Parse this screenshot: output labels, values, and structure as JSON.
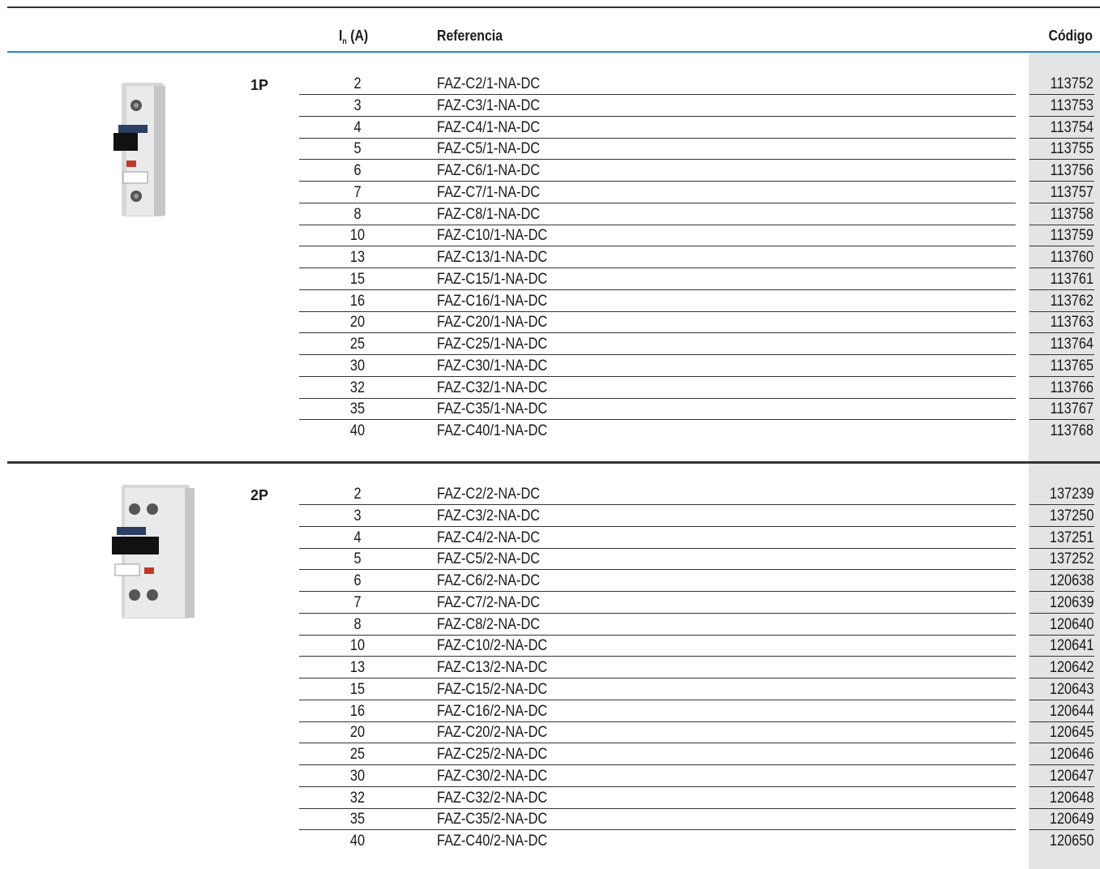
{
  "header": {
    "in_main": "I",
    "in_sub": "n",
    "in_unit": " (A)",
    "ref": "Referencia",
    "code": "Código"
  },
  "sections": [
    {
      "pole": "1P",
      "rows": [
        {
          "in": "2",
          "ref": "FAZ-C2/1-NA-DC",
          "code": "113752"
        },
        {
          "in": "3",
          "ref": "FAZ-C3/1-NA-DC",
          "code": "113753"
        },
        {
          "in": "4",
          "ref": "FAZ-C4/1-NA-DC",
          "code": "113754"
        },
        {
          "in": "5",
          "ref": "FAZ-C5/1-NA-DC",
          "code": "113755"
        },
        {
          "in": "6",
          "ref": "FAZ-C6/1-NA-DC",
          "code": "113756"
        },
        {
          "in": "7",
          "ref": "FAZ-C7/1-NA-DC",
          "code": "113757"
        },
        {
          "in": "8",
          "ref": "FAZ-C8/1-NA-DC",
          "code": "113758"
        },
        {
          "in": "10",
          "ref": "FAZ-C10/1-NA-DC",
          "code": "113759"
        },
        {
          "in": "13",
          "ref": "FAZ-C13/1-NA-DC",
          "code": "113760"
        },
        {
          "in": "15",
          "ref": "FAZ-C15/1-NA-DC",
          "code": "113761"
        },
        {
          "in": "16",
          "ref": "FAZ-C16/1-NA-DC",
          "code": "113762"
        },
        {
          "in": "20",
          "ref": "FAZ-C20/1-NA-DC",
          "code": "113763"
        },
        {
          "in": "25",
          "ref": "FAZ-C25/1-NA-DC",
          "code": "113764"
        },
        {
          "in": "30",
          "ref": "FAZ-C30/1-NA-DC",
          "code": "113765"
        },
        {
          "in": "32",
          "ref": "FAZ-C32/1-NA-DC",
          "code": "113766"
        },
        {
          "in": "35",
          "ref": "FAZ-C35/1-NA-DC",
          "code": "113767"
        },
        {
          "in": "40",
          "ref": "FAZ-C40/1-NA-DC",
          "code": "113768"
        }
      ]
    },
    {
      "pole": "2P",
      "rows": [
        {
          "in": "2",
          "ref": "FAZ-C2/2-NA-DC",
          "code": "137239"
        },
        {
          "in": "3",
          "ref": "FAZ-C3/2-NA-DC",
          "code": "137250"
        },
        {
          "in": "4",
          "ref": "FAZ-C4/2-NA-DC",
          "code": "137251"
        },
        {
          "in": "5",
          "ref": "FAZ-C5/2-NA-DC",
          "code": "137252"
        },
        {
          "in": "6",
          "ref": "FAZ-C6/2-NA-DC",
          "code": "120638"
        },
        {
          "in": "7",
          "ref": "FAZ-C7/2-NA-DC",
          "code": "120639"
        },
        {
          "in": "8",
          "ref": "FAZ-C8/2-NA-DC",
          "code": "120640"
        },
        {
          "in": "10",
          "ref": "FAZ-C10/2-NA-DC",
          "code": "120641"
        },
        {
          "in": "13",
          "ref": "FAZ-C13/2-NA-DC",
          "code": "120642"
        },
        {
          "in": "15",
          "ref": "FAZ-C15/2-NA-DC",
          "code": "120643"
        },
        {
          "in": "16",
          "ref": "FAZ-C16/2-NA-DC",
          "code": "120644"
        },
        {
          "in": "20",
          "ref": "FAZ-C20/2-NA-DC",
          "code": "120645"
        },
        {
          "in": "25",
          "ref": "FAZ-C25/2-NA-DC",
          "code": "120646"
        },
        {
          "in": "30",
          "ref": "FAZ-C30/2-NA-DC",
          "code": "120647"
        },
        {
          "in": "32",
          "ref": "FAZ-C32/2-NA-DC",
          "code": "120648"
        },
        {
          "in": "35",
          "ref": "FAZ-C35/2-NA-DC",
          "code": "120649"
        },
        {
          "in": "40",
          "ref": "FAZ-C40/2-NA-DC",
          "code": "120650"
        }
      ]
    }
  ],
  "colors": {
    "accent_rule": "#1e88d1",
    "code_band": "#e3e4e6",
    "text": "#1a1a1a"
  }
}
